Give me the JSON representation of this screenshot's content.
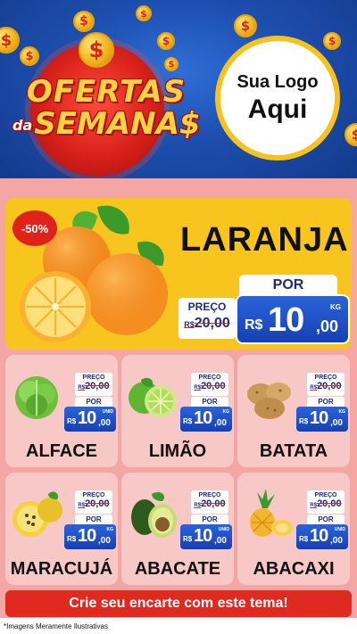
{
  "header": {
    "title_line1": "OFERTAS",
    "title_da": "da",
    "title_line2": "SEMANA$",
    "coin_symbol": "$",
    "logo_line1": "Sua Logo",
    "logo_line2": "Aqui"
  },
  "featured": {
    "discount": "-50%",
    "name": "LARANJA",
    "was_label": "PREÇO",
    "was_currency": "R$",
    "was_price": "20,00",
    "now_label": "POR",
    "currency": "R$",
    "price_int": "10",
    "price_dec": ",00",
    "unit": "KG"
  },
  "products": [
    {
      "name": "ALFACE",
      "was_label": "PREÇO",
      "was_currency": "R$",
      "was_price": "20,00",
      "now_label": "POR",
      "currency": "R$",
      "price_int": "10",
      "price_dec": ",00",
      "unit": "UNID"
    },
    {
      "name": "LIMÃO",
      "was_label": "PREÇO",
      "was_currency": "R$",
      "was_price": "20,00",
      "now_label": "POR",
      "currency": "R$",
      "price_int": "10",
      "price_dec": ",00",
      "unit": "KG"
    },
    {
      "name": "BATATA",
      "was_label": "PREÇO",
      "was_currency": "R$",
      "was_price": "20,00",
      "now_label": "POR",
      "currency": "R$",
      "price_int": "10",
      "price_dec": ",00",
      "unit": "KG"
    },
    {
      "name": "MARACUJÁ",
      "was_label": "PREÇO",
      "was_currency": "R$",
      "was_price": "20,00",
      "now_label": "POR",
      "currency": "R$",
      "price_int": "10",
      "price_dec": ",00",
      "unit": "KG"
    },
    {
      "name": "ABACATE",
      "was_label": "PREÇO",
      "was_currency": "R$",
      "was_price": "20,00",
      "now_label": "POR",
      "currency": "R$",
      "price_int": "10",
      "price_dec": ",00",
      "unit": "UNID"
    },
    {
      "name": "ABACAXI",
      "was_label": "PREÇO",
      "was_currency": "R$",
      "was_price": "20,00",
      "now_label": "POR",
      "currency": "R$",
      "price_int": "10",
      "price_dec": ",00",
      "unit": "UNID"
    }
  ],
  "footer": {
    "cta": "Crie seu encarte com este tema!",
    "disclaimer": "*Imagens Meramente Ilustrativas"
  },
  "colors": {
    "header_blue": "#1d4fb0",
    "accent_red": "#e02a20",
    "accent_yellow": "#f7c51e",
    "card_pink": "#f8c8c6",
    "price_blue": "#1640b5"
  }
}
